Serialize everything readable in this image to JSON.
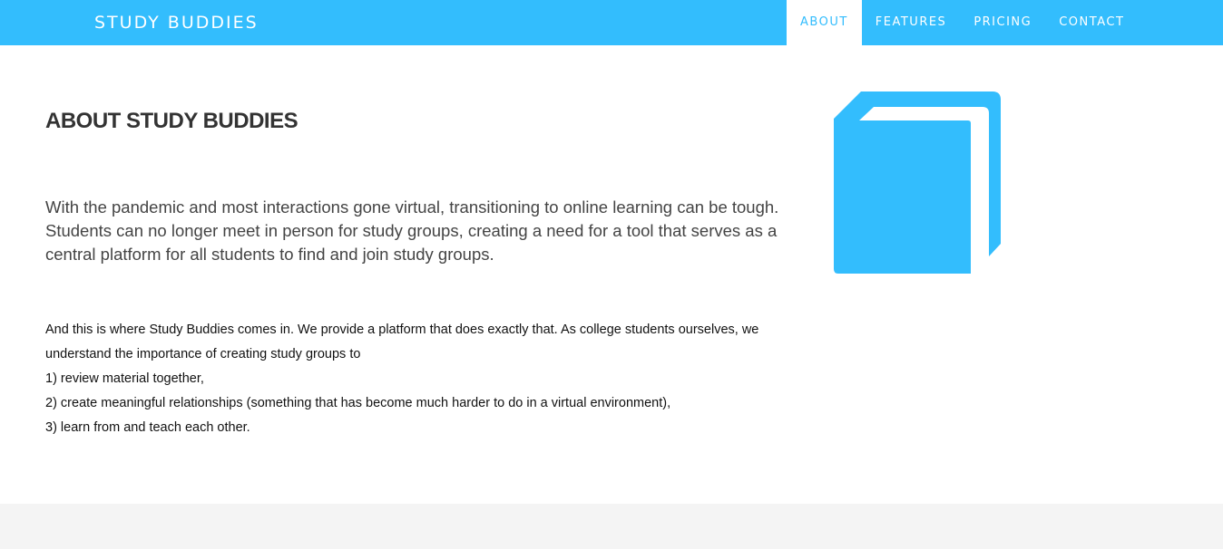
{
  "navbar": {
    "brand": "STUDY BUDDIES",
    "items": [
      {
        "label": "ABOUT",
        "active": true
      },
      {
        "label": "FEATURES",
        "active": false
      },
      {
        "label": "PRICING",
        "active": false
      },
      {
        "label": "CONTACT",
        "active": false
      }
    ]
  },
  "about": {
    "title": "ABOUT STUDY BUDDIES",
    "lead": "With the pandemic and most interactions gone virtual, transitioning to online learning can be tough. Students can no longer meet in person for study groups, creating a need for a tool that serves as a central platform for all students to find and join study groups.",
    "intro": "And this is where Study Buddies comes in. We provide a platform that does exactly that. As college students ourselves, we understand the importance of creating study groups to",
    "points": [
      "1) review material together,",
      "2) create meaningful relationships (something that has become much harder to do in a virtual environment),",
      "3) learn from and teach each other."
    ],
    "icon": "book-icon"
  },
  "colors": {
    "accent": "#33bdfd",
    "footer": "#f4f4f4"
  }
}
